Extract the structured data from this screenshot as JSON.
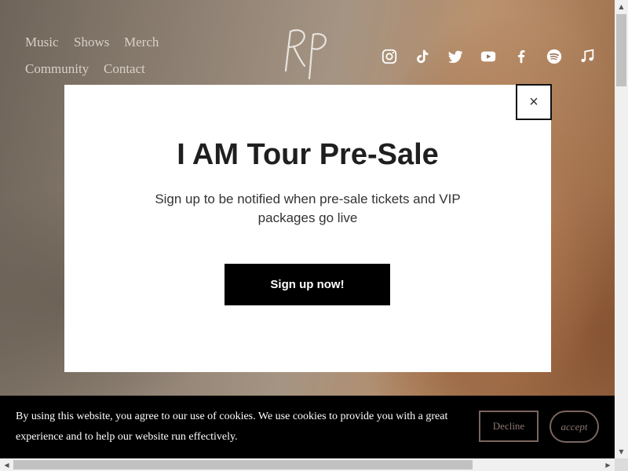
{
  "nav": {
    "items": [
      "Music",
      "Shows",
      "Merch",
      "Community",
      "Contact"
    ]
  },
  "logo": {
    "text": "RP"
  },
  "social": {
    "icons": [
      "instagram-icon",
      "tiktok-icon",
      "twitter-icon",
      "youtube-icon",
      "facebook-icon",
      "spotify-icon",
      "music-note-icon"
    ]
  },
  "modal": {
    "close_label": "×",
    "title": "I AM Tour Pre-Sale",
    "text": "Sign up to be notified when pre-sale tickets and VIP packages go live",
    "button_label": "Sign up now!"
  },
  "cookie": {
    "text": "By using this website, you agree to our use of cookies. We use cookies to provide you with a great experience and to help our website run effectively.",
    "decline_label": "Decline",
    "accept_label": "accept"
  },
  "colors": {
    "overlay_bg": "#000000",
    "modal_bg": "#ffffff",
    "cookie_button_border": "#7a655f",
    "cookie_button_text": "#8b7771"
  }
}
